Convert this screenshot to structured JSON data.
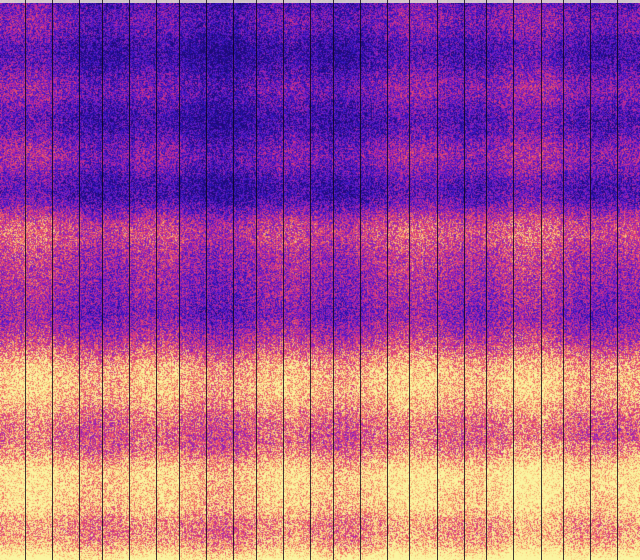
{
  "image": {
    "kind": "spectrogram",
    "colormap": "plasma",
    "colors": {
      "low": "#2a10b8",
      "mid_low": "#7a1fc0",
      "mid": "#d0308a",
      "mid_high": "#f06e5a",
      "high": "#f8e890",
      "gridline": "#0a0514"
    },
    "column_dividers": 24,
    "bands": [
      {
        "intensity": 0.18
      },
      {
        "intensity": 0.32
      },
      {
        "intensity": 0.42
      },
      {
        "intensity": 0.3
      },
      {
        "intensity": 0.55
      },
      {
        "intensity": 0.35
      },
      {
        "intensity": 0.72
      },
      {
        "intensity": 0.48
      },
      {
        "intensity": 0.88
      },
      {
        "intensity": 0.66
      }
    ]
  }
}
